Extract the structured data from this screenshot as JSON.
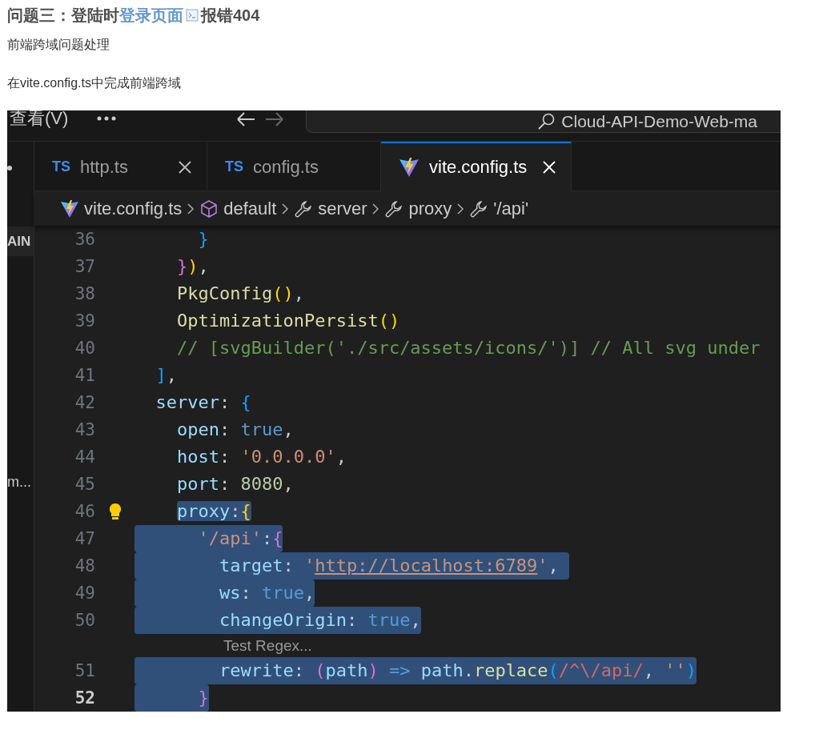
{
  "article": {
    "heading": {
      "before": "问题三：登陆时",
      "link": "登录页面",
      "after": "报错404"
    },
    "paragraphs": [
      "前端跨域问题处理",
      "在vite.config.ts中完成前端跨域"
    ]
  },
  "editor": {
    "menu_label": "查看(V)",
    "search_text": "Cloud-API-Demo-Web-ma",
    "sidebar": {
      "header": "AIN",
      "item": "m..."
    },
    "tabs": [
      {
        "kind": "ts",
        "icon_label": "TS",
        "label": "http.ts",
        "selected": false,
        "closable": true
      },
      {
        "kind": "ts",
        "icon_label": "TS",
        "label": "config.ts",
        "selected": false,
        "closable": false
      },
      {
        "kind": "vite",
        "label": "vite.config.ts",
        "selected": true,
        "closable": true
      }
    ],
    "breadcrumb": [
      {
        "kind": "file",
        "label": "vite.config.ts"
      },
      {
        "kind": "module",
        "label": "default"
      },
      {
        "kind": "property",
        "label": "server"
      },
      {
        "kind": "property",
        "label": "proxy"
      },
      {
        "kind": "property",
        "label": "'/api'"
      }
    ],
    "code": {
      "lines": [
        {
          "kind": "line",
          "number": "36",
          "selected": false,
          "tokens": [
            {
              "kind": "b3",
              "text": "      }"
            }
          ]
        },
        {
          "kind": "line",
          "number": "37",
          "selected": false,
          "tokens": [
            {
              "kind": "b2",
              "text": "    }"
            },
            {
              "kind": "b1",
              "text": ")"
            },
            {
              "kind": "plain",
              "text": ","
            }
          ]
        },
        {
          "kind": "line",
          "number": "38",
          "selected": false,
          "tokens": [
            {
              "kind": "fn",
              "text": "    PkgConfig"
            },
            {
              "kind": "b1",
              "text": "()"
            },
            {
              "kind": "plain",
              "text": ","
            }
          ]
        },
        {
          "kind": "line",
          "number": "39",
          "selected": false,
          "tokens": [
            {
              "kind": "fn",
              "text": "    OptimizationPersist"
            },
            {
              "kind": "b1",
              "text": "()"
            }
          ]
        },
        {
          "kind": "line",
          "number": "40",
          "selected": false,
          "tokens": [
            {
              "kind": "comment",
              "text": "    // [svgBuilder('./src/assets/icons/')] // All svg under"
            }
          ]
        },
        {
          "kind": "line",
          "number": "41",
          "selected": false,
          "tokens": [
            {
              "kind": "b3",
              "text": "  ]"
            },
            {
              "kind": "plain",
              "text": ","
            }
          ]
        },
        {
          "kind": "line",
          "number": "42",
          "selected": false,
          "tokens": [
            {
              "kind": "prop",
              "text": "  server"
            },
            {
              "kind": "plain",
              "text": ": "
            },
            {
              "kind": "b3",
              "text": "{"
            }
          ]
        },
        {
          "kind": "line",
          "number": "43",
          "selected": false,
          "tokens": [
            {
              "kind": "prop",
              "text": "    open"
            },
            {
              "kind": "plain",
              "text": ": "
            },
            {
              "kind": "kw",
              "text": "true"
            },
            {
              "kind": "plain",
              "text": ","
            }
          ]
        },
        {
          "kind": "line",
          "number": "44",
          "selected": false,
          "tokens": [
            {
              "kind": "prop",
              "text": "    host"
            },
            {
              "kind": "plain",
              "text": ": "
            },
            {
              "kind": "str",
              "text": "'0.0.0.0'"
            },
            {
              "kind": "plain",
              "text": ","
            }
          ]
        },
        {
          "kind": "line",
          "number": "45",
          "selected": false,
          "tokens": [
            {
              "kind": "prop",
              "text": "    port"
            },
            {
              "kind": "plain",
              "text": ": "
            },
            {
              "kind": "num",
              "text": "8080"
            },
            {
              "kind": "plain",
              "text": ","
            }
          ]
        },
        {
          "kind": "line",
          "number": "46",
          "lightbulb": true,
          "selected": true,
          "indent_selected": false,
          "tokens": [
            {
              "kind": "prop",
              "text": "    proxy"
            },
            {
              "kind": "plain",
              "text": ":"
            },
            {
              "kind": "b1",
              "text": "{"
            }
          ]
        },
        {
          "kind": "line",
          "number": "47",
          "selected": true,
          "indent_selected": true,
          "tokens": [
            {
              "kind": "str",
              "text": "      '/api'"
            },
            {
              "kind": "plain",
              "text": ":"
            },
            {
              "kind": "b2",
              "text": "{"
            }
          ]
        },
        {
          "kind": "line",
          "number": "48",
          "selected": true,
          "indent_selected": true,
          "tokens": [
            {
              "kind": "prop",
              "text": "        target"
            },
            {
              "kind": "plain",
              "text": ": "
            },
            {
              "kind": "str",
              "text": "'"
            },
            {
              "kind": "url",
              "text": "http://localhost:6789"
            },
            {
              "kind": "str",
              "text": "'"
            },
            {
              "kind": "plain",
              "text": ", "
            }
          ]
        },
        {
          "kind": "line",
          "number": "49",
          "selected": true,
          "indent_selected": true,
          "tokens": [
            {
              "kind": "prop",
              "text": "        ws"
            },
            {
              "kind": "plain",
              "text": ": "
            },
            {
              "kind": "kw",
              "text": "true"
            },
            {
              "kind": "plain",
              "text": ","
            }
          ]
        },
        {
          "kind": "line",
          "number": "50",
          "selected": true,
          "indent_selected": true,
          "tokens": [
            {
              "kind": "prop",
              "text": "        changeOrigin"
            },
            {
              "kind": "plain",
              "text": ": "
            },
            {
              "kind": "kw",
              "text": "true"
            },
            {
              "kind": "plain",
              "text": ","
            }
          ]
        },
        {
          "kind": "codelens",
          "text": "Test Regex..."
        },
        {
          "kind": "line",
          "number": "51",
          "selected": true,
          "indent_selected": true,
          "tokens": [
            {
              "kind": "prop",
              "text": "        rewrite"
            },
            {
              "kind": "plain",
              "text": ": "
            },
            {
              "kind": "b2",
              "text": "("
            },
            {
              "kind": "prop",
              "text": "path"
            },
            {
              "kind": "b2",
              "text": ")"
            },
            {
              "kind": "kw",
              "text": " => "
            },
            {
              "kind": "prop",
              "text": "path"
            },
            {
              "kind": "plain",
              "text": "."
            },
            {
              "kind": "fn",
              "text": "replace"
            },
            {
              "kind": "b3",
              "text": "("
            },
            {
              "kind": "regex",
              "text": "/^\\/api/"
            },
            {
              "kind": "plain",
              "text": ", "
            },
            {
              "kind": "str",
              "text": "''"
            },
            {
              "kind": "b3",
              "text": ")"
            }
          ]
        },
        {
          "kind": "line",
          "number": "52",
          "current": true,
          "selected": true,
          "indent_selected": true,
          "tokens": [
            {
              "kind": "b2",
              "text": "      }"
            }
          ]
        }
      ]
    }
  }
}
